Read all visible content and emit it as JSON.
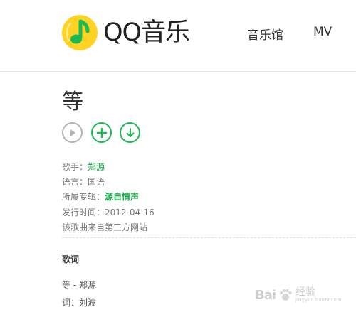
{
  "header": {
    "logo_text": "QQ音乐",
    "nav": [
      "音乐馆",
      "MV"
    ],
    "brand_colors": {
      "logo_yellow": "#FFD323",
      "logo_green": "#1DB954"
    }
  },
  "song": {
    "title": "等",
    "actions": [
      {
        "name": "play",
        "icon": "play-icon"
      },
      {
        "name": "add",
        "icon": "plus-icon"
      },
      {
        "name": "download",
        "icon": "download-icon"
      }
    ],
    "info": {
      "singer_label": "歌手：",
      "singer": "郑源",
      "language_label": "语言：",
      "language": "国语",
      "album_label": "所属专辑：",
      "album": "源自情声",
      "release_label": "发行时间：",
      "release": "2012-04-16",
      "source_note": "该歌曲来自第三方网站"
    }
  },
  "lyrics": {
    "title": "歌词",
    "lines": [
      "等 - 郑源",
      "词：刘波"
    ]
  },
  "watermark": {
    "text": "Bai",
    "cn": "经验",
    "sub": "jingyan.baidu.com"
  }
}
